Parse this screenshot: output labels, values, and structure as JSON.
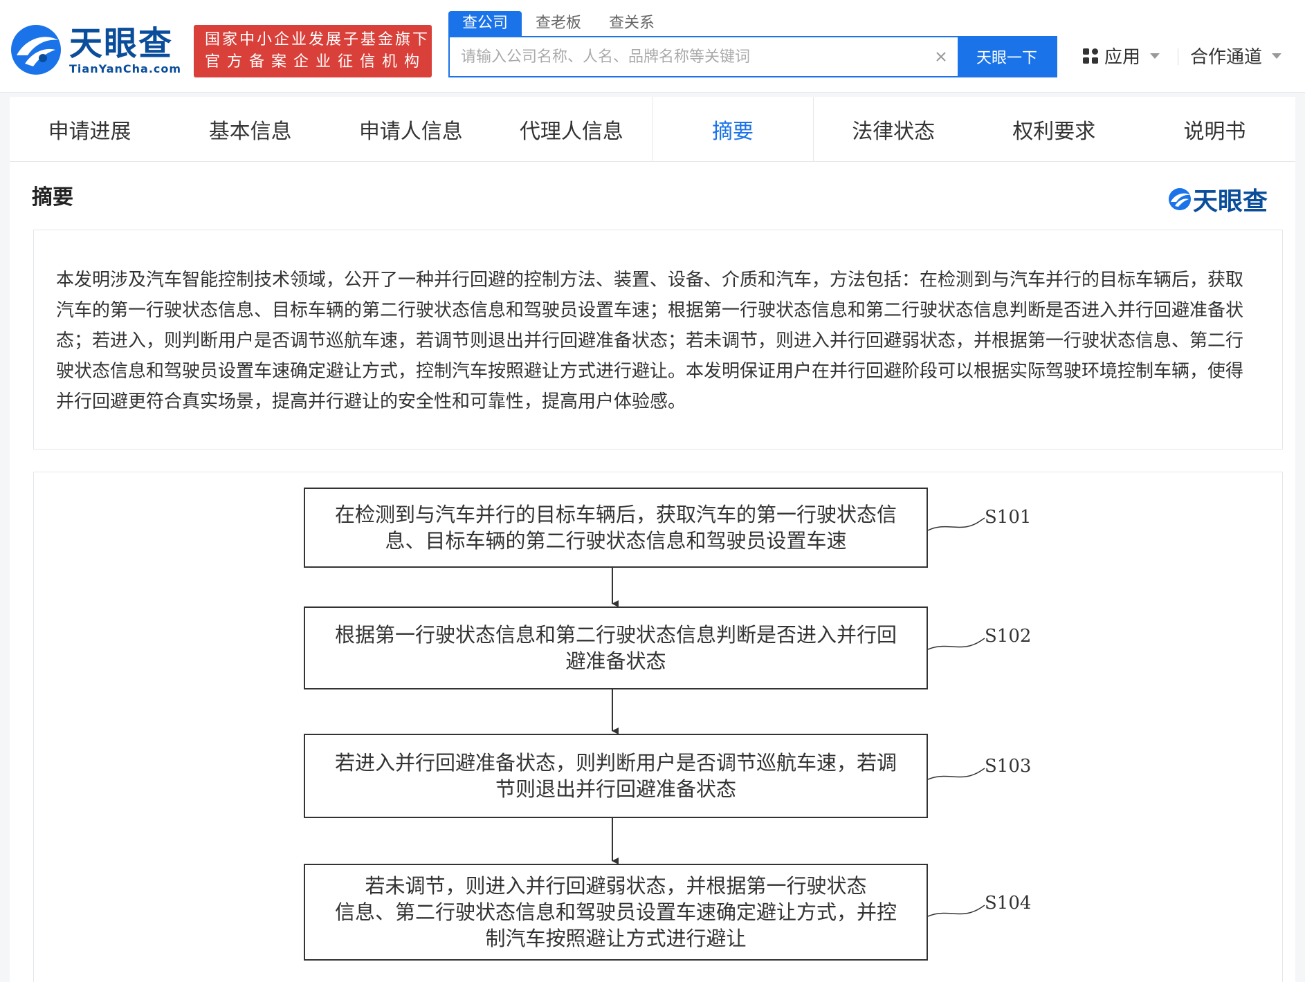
{
  "header": {
    "logo_cn": "天眼查",
    "logo_en": "TianYanCha.com",
    "badge_line1": "国家中小企业发展子基金旗下",
    "badge_line2": "官方备案企业征信机构",
    "search_tabs": [
      {
        "label": "查公司",
        "active": true
      },
      {
        "label": "查老板",
        "active": false
      },
      {
        "label": "查关系",
        "active": false
      }
    ],
    "search_placeholder": "请输入公司名称、人名、品牌名称等关键词",
    "search_button": "天眼一下",
    "apps_label": "应用",
    "coop_label": "合作通道",
    "accent_color": "#1a73e8",
    "badge_color": "#d9403a"
  },
  "nav": {
    "tabs": [
      {
        "label": "申请进展",
        "active": false
      },
      {
        "label": "基本信息",
        "active": false
      },
      {
        "label": "申请人信息",
        "active": false
      },
      {
        "label": "代理人信息",
        "active": false
      },
      {
        "label": "摘要",
        "active": true
      },
      {
        "label": "法律状态",
        "active": false
      },
      {
        "label": "权利要求",
        "active": false
      },
      {
        "label": "说明书",
        "active": false
      }
    ]
  },
  "section": {
    "title": "摘要",
    "watermark": "天眼查",
    "abstract_text": "本发明涉及汽车智能控制技术领域，公开了一种并行回避的控制方法、装置、设备、介质和汽车，方法包括：在检测到与汽车并行的目标车辆后，获取汽车的第一行驶状态信息、目标车辆的第二行驶状态信息和驾驶员设置车速；根据第一行驶状态信息和第二行驶状态信息判断是否进入并行回避准备状态；若进入，则判断用户是否调节巡航车速，若调节则退出并行回避准备状态；若未调节，则进入并行回避弱状态，并根据第一行驶状态信息、第二行驶状态信息和驾驶员设置车速确定避让方式，控制汽车按照避让方式进行避让。本发明保证用户在并行回避阶段可以根据实际驾驶环境控制车辆，使得并行回避更符合真实场景，提高并行避让的安全性和可靠性，提高用户体验感。"
  },
  "flowchart": {
    "steps": [
      {
        "label": "S101",
        "lines": [
          "在检测到与汽车并行的目标车辆后，获取汽车的第一行驶状态信",
          "息、目标车辆的第二行驶状态信息和驾驶员设置车速"
        ]
      },
      {
        "label": "S102",
        "lines": [
          "根据第一行驶状态信息和第二行驶状态信息判断是否进入并行回",
          "避准备状态"
        ]
      },
      {
        "label": "S103",
        "lines": [
          "若进入并行回避准备状态，则判断用户是否调节巡航车速，若调",
          "节则退出并行回避准备状态"
        ]
      },
      {
        "label": "S104",
        "lines": [
          "若未调节，则进入并行回避弱状态，并根据第一行驶状态",
          "信息、第二行驶状态信息和驾驶员设置车速确定避让方式，并控",
          "制汽车按照避让方式进行避让"
        ]
      }
    ]
  }
}
